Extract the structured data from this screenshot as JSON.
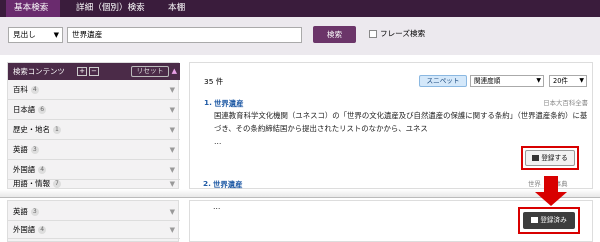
{
  "nav": {
    "tabs": [
      {
        "label": "基本検索"
      },
      {
        "label": "詳細（個別）検索"
      },
      {
        "label": "本棚"
      }
    ]
  },
  "search": {
    "scope_selected": "見出し",
    "query_value": "世界遺産",
    "search_button_label": "検索",
    "phrase_search_label": "フレーズ検索"
  },
  "sidebar": {
    "title": "検索コンテンツ",
    "plus_label": "+",
    "minus_label": "−",
    "reset_label": "リセット",
    "categories": [
      {
        "label": "百科",
        "count": "4"
      },
      {
        "label": "日本語",
        "count": "6"
      },
      {
        "label": "歴史・地名",
        "count": "1"
      },
      {
        "label": "英語",
        "count": "3"
      },
      {
        "label": "外国語",
        "count": "4"
      },
      {
        "label": "用語・情報",
        "count": "7"
      }
    ],
    "bottom_categories": [
      {
        "label": "英語",
        "count": "3"
      },
      {
        "label": "外国語",
        "count": "4"
      }
    ]
  },
  "results": {
    "count_text": "35 件",
    "snippet_button_label": "スニペット",
    "sort_selected": "関連度順",
    "per_page_selected": "20件",
    "items": [
      {
        "num": "1.",
        "title": "世界遺産",
        "source": "日本大百科全書",
        "snippet": "国連教育科学文化機関（ユネスコ）の「世界の文化遺産及び自然遺産の保護に関する条約」（世界遺産条約）に基づき、その条約締結国から提出されたリストのなかから、ユネス",
        "ellipsis": "…"
      },
      {
        "num": "2.",
        "title": "世界遺産",
        "source": "世界",
        "source_suffix": "事典",
        "ellipsis": "…"
      }
    ],
    "register_label": "登録する",
    "registered_label": "登録済み"
  }
}
